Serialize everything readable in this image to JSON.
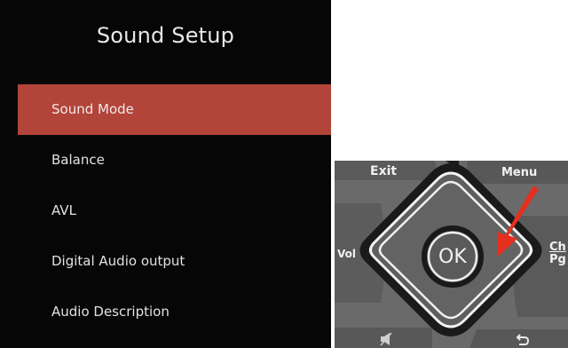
{
  "menu": {
    "title": "Sound Setup",
    "items": [
      {
        "label": "Sound Mode",
        "selected": true
      },
      {
        "label": "Balance"
      },
      {
        "label": "AVL"
      },
      {
        "label": "Digital Audio output"
      },
      {
        "label": "Audio Description"
      }
    ],
    "highlight_color": "#b2443a"
  },
  "remote": {
    "exit_label": "Exit",
    "menu_label": "Menu",
    "vol_label": "Vol",
    "ok_label": "OK",
    "ch_label": "Ch",
    "pg_label": "Pg",
    "mute_icon": "mute-icon",
    "back_icon": "back-arrow-icon",
    "arrow_color": "#e5301f"
  }
}
